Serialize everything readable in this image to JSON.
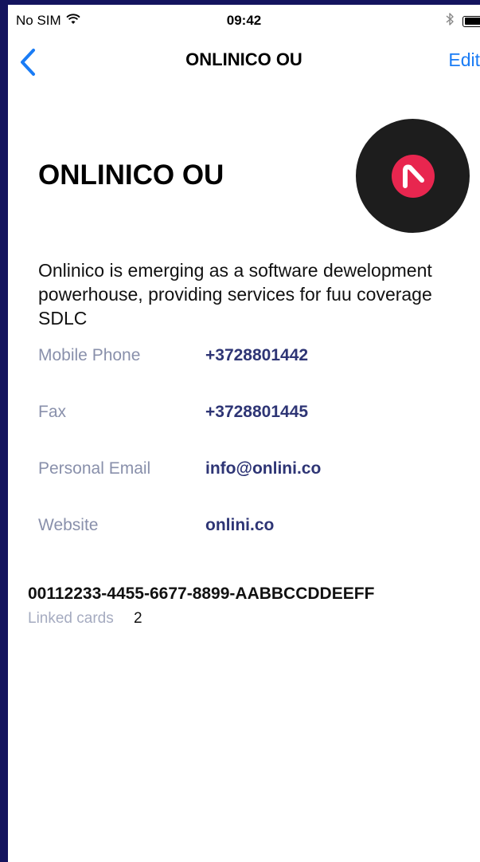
{
  "status_bar": {
    "carrier": "No SIM",
    "time": "09:42"
  },
  "nav": {
    "title": "ONLINICO OU",
    "edit_label": "Edit"
  },
  "company": {
    "name": "ONLINICO OU",
    "description": "Onlinico is emerging as a software dewelopment powerhouse, providing services for fuu coverage SDLC",
    "logo_colors": {
      "background": "#1d1d1d",
      "mark": "#e8264f"
    }
  },
  "contact": [
    {
      "label": "Mobile Phone",
      "value": "+3728801442"
    },
    {
      "label": "Fax",
      "value": "+3728801445"
    },
    {
      "label": "Personal Email",
      "value": "info@onlini.co"
    },
    {
      "label": "Website",
      "value": "onlini.co"
    }
  ],
  "card": {
    "id": "00112233-4455-6677-8899-AABBCCDDEEFF",
    "linked_label": "Linked cards",
    "linked_count": "2"
  },
  "colors": {
    "accent": "#1a7cf5",
    "value_text": "#2e3575",
    "label_text": "#8990ab",
    "frame": "#14145e"
  },
  "icons": {
    "back": "chevron-left-icon",
    "wifi": "wifi-icon",
    "bluetooth": "bluetooth-icon",
    "battery": "battery-icon"
  }
}
